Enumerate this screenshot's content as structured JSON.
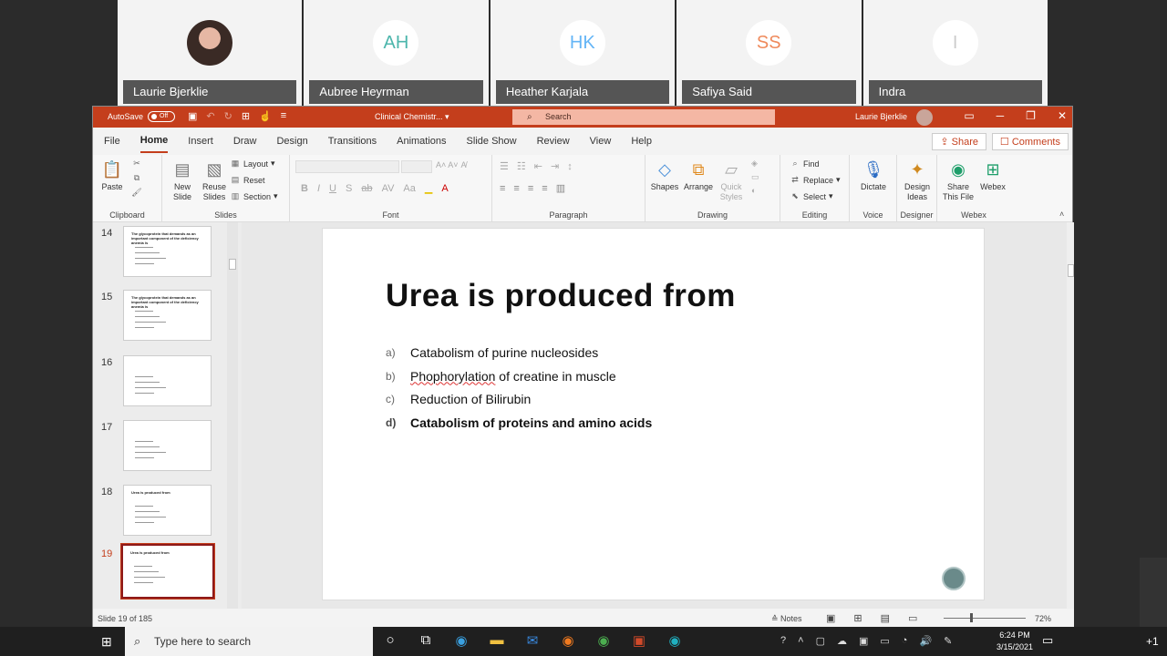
{
  "participants": [
    {
      "name": "Laurie Bjerklie",
      "initials": "",
      "photo": true,
      "color": "#333333"
    },
    {
      "name": "Aubree Heyrman",
      "initials": "AH",
      "photo": false,
      "color": "#4db6ac"
    },
    {
      "name": "Heather Karjala",
      "initials": "HK",
      "photo": false,
      "color": "#64b5f6"
    },
    {
      "name": "Safiya Said",
      "initials": "SS",
      "photo": false,
      "color": "#ef8a5c"
    },
    {
      "name": "Indra",
      "initials": "I",
      "photo": false,
      "color": "#cccccc"
    }
  ],
  "titlebar": {
    "autosave_label": "AutoSave",
    "autosave_state": "Off",
    "document": "Clinical Chemistr...",
    "search_placeholder": "Search",
    "user": "Laurie Bjerklie"
  },
  "tabs": [
    "File",
    "Home",
    "Insert",
    "Draw",
    "Design",
    "Transitions",
    "Animations",
    "Slide Show",
    "Review",
    "View",
    "Help"
  ],
  "active_tab": "Home",
  "share_label": "Share",
  "comments_label": "Comments",
  "ribbon": {
    "clipboard": {
      "paste": "Paste",
      "label": "Clipboard"
    },
    "slides": {
      "new_slide": "New Slide",
      "reuse_slides": "Reuse Slides",
      "layout": "Layout",
      "reset": "Reset",
      "section": "Section",
      "label": "Slides"
    },
    "font": {
      "label": "Font"
    },
    "paragraph": {
      "label": "Paragraph"
    },
    "drawing": {
      "shapes": "Shapes",
      "arrange": "Arrange",
      "quick_styles": "Quick Styles",
      "label": "Drawing"
    },
    "editing": {
      "find": "Find",
      "replace": "Replace",
      "select": "Select",
      "label": "Editing"
    },
    "voice": {
      "dictate": "Dictate",
      "label": "Voice"
    },
    "designer": {
      "design_ideas": "Design Ideas",
      "label": "Designer"
    },
    "webex": {
      "share_file": "Share This File",
      "webex": "Webex",
      "label": "Webex"
    }
  },
  "thumbnails": [
    {
      "num": "14",
      "title": "The glycoprotein that demands as an important component of the deficiency anemia is",
      "selected": false
    },
    {
      "num": "15",
      "title": "The glycoprotein that demands as an important component of the deficiency anemia is",
      "selected": false
    },
    {
      "num": "16",
      "title": "",
      "selected": false
    },
    {
      "num": "17",
      "title": "",
      "selected": false
    },
    {
      "num": "18",
      "title": "Urea is produced from",
      "selected": false
    },
    {
      "num": "19",
      "title": "Urea is produced from",
      "selected": true
    }
  ],
  "slide": {
    "title": "Urea is produced from",
    "options": [
      {
        "letter": "a)",
        "pre": "",
        "squiggle": "",
        "text": "Catabolism of purine nucleosides",
        "bold": false
      },
      {
        "letter": "b)",
        "pre": "",
        "squiggle": "Phophorylation",
        "text": " of creatine in muscle",
        "bold": false
      },
      {
        "letter": "c)",
        "pre": "",
        "squiggle": "",
        "text": "Reduction of Bilirubin",
        "bold": false
      },
      {
        "letter": "d)",
        "pre": "",
        "squiggle": "",
        "text": "Catabolism of proteins and amino acids",
        "bold": true
      }
    ]
  },
  "status": {
    "slide_count": "Slide 19 of 185",
    "notes": "Notes",
    "zoom": "72%"
  },
  "taskbar": {
    "search_placeholder": "Type here to search",
    "time": "6:24 PM",
    "date": "3/15/2021",
    "overflow": "+1"
  }
}
